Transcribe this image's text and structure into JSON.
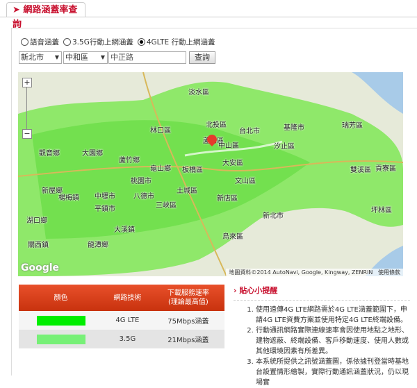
{
  "tab": {
    "title": "網路涵蓋率查詢",
    "icon": "arrow-right-icon"
  },
  "radios": [
    {
      "label": "語音涵蓋",
      "checked": false
    },
    {
      "label": "3.5G行動上網涵蓋",
      "checked": false
    },
    {
      "label": "4GLTE 行動上網涵蓋",
      "checked": true
    }
  ],
  "city": "新北市",
  "district": "中和區",
  "road": "中正路",
  "search_label": "查詢",
  "map": {
    "zoom_in": "+",
    "zoom_out": "−",
    "logo": "Google",
    "attribution": "地圖資料©2014 AutoNavi, Google, Kingway, ZENRIN",
    "terms": "使用條款",
    "labels": [
      "淡水區",
      "北投區",
      "林口區",
      "蘆洲區",
      "台北市",
      "基隆市",
      "瑞芳區",
      "中山區",
      "汐止區",
      "觀音鄉",
      "大園鄉",
      "蘆竹鄉",
      "龜山鄉",
      "板橋區",
      "大安區",
      "雙溪區",
      "貢寮區",
      "新屋鄉",
      "中壢市",
      "桃園市",
      "八德市",
      "土城區",
      "文山區",
      "新店區",
      "楊梅鎮",
      "平鎮市",
      "三峽區",
      "坪林區",
      "新北市",
      "湖口鄉",
      "大溪鎮",
      "烏來區",
      "龍潭鄉",
      "關西鎮"
    ]
  },
  "legend": {
    "headers": [
      "顏色",
      "網路技術",
      "下載服務速率\n(理論最高值)"
    ],
    "rows": [
      {
        "color": "#00ee00",
        "tech": "4G LTE",
        "speed": "75Mbps涵蓋"
      },
      {
        "color": "#77f077",
        "tech": "3.5G",
        "speed": "21Mbps涵蓋"
      }
    ]
  },
  "tips": {
    "title": "貼心小提醒",
    "items": [
      "使用遠傳4G LTE網路需於4G LTE涵蓋範圍下，申請4G LTE資費方案並使用特定4G LTE終端設備。",
      "行動通訊網路實際連線速率會因使用地點之地形、建物遮蔽、終端設備、客戶移動速度、使用人數或其他環境因素有所差異。",
      "本系統所提供之訊號涵蓋圖，係依據刊登當時基地台設置情形繪製，實際行動通訊涵蓋狀況，仍以現場實"
    ]
  }
}
